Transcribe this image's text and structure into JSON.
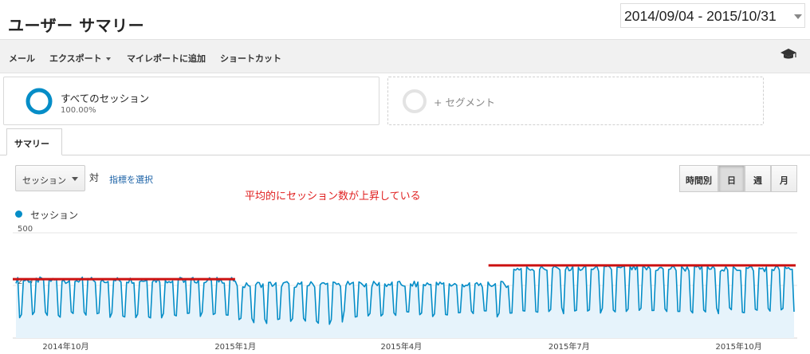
{
  "header": {
    "title": "ユーザー サマリー",
    "date_range": "2014/09/04 - 2015/10/31"
  },
  "toolbar": {
    "email": "メール",
    "export": "エクスポート",
    "add_to_dashboard": "マイレポートに追加",
    "shortcut": "ショートカット",
    "help_icon": "graduation-cap-icon"
  },
  "segments": {
    "active": {
      "name": "すべてのセッション",
      "percent": "100.00%",
      "color": "#058dc7"
    },
    "add_label": "+ セグメント"
  },
  "tabs": {
    "summary": "サマリー"
  },
  "chart_controls": {
    "metric": "セッション",
    "vs": "対",
    "select_metric": "指標を選択",
    "granularity": [
      "時間別",
      "日",
      "週",
      "月"
    ],
    "granularity_active": "日"
  },
  "annotation": {
    "text": "平均的にセッション数が上昇している",
    "color": "#e02020"
  },
  "chart_data": {
    "type": "area",
    "series": [
      {
        "name": "セッション",
        "color": "#058dc7"
      }
    ],
    "x_range": [
      "2014-09-04",
      "2015-10-31"
    ],
    "y_ticks": [
      "500",
      "250"
    ],
    "ylim": [
      0,
      500
    ],
    "x_tick_labels": [
      "2014年10月",
      "2015年1月",
      "2015年4月",
      "2015年7月",
      "2015年10月"
    ],
    "pattern": "weekly",
    "segments": [
      {
        "from": "2014-09-04",
        "to": "2014-12-31",
        "weekday_sessions": 275,
        "weekend_sessions": 110
      },
      {
        "from": "2015-01-01",
        "to": "2015-02-28",
        "weekday_sessions": 255,
        "weekend_sessions": 80
      },
      {
        "from": "2015-03-01",
        "to": "2015-05-31",
        "weekday_sessions": 255,
        "weekend_sessions": 115
      },
      {
        "from": "2015-06-01",
        "to": "2015-10-31",
        "weekday_sessions": 330,
        "weekend_sessions": 130
      }
    ],
    "reference_lines": [
      {
        "from": "2014-09-04",
        "to": "2014-12-31",
        "value": 280,
        "color": "#cc1111"
      },
      {
        "from": "2015-05-20",
        "to": "2015-10-31",
        "value": 345,
        "color": "#cc1111"
      }
    ]
  }
}
